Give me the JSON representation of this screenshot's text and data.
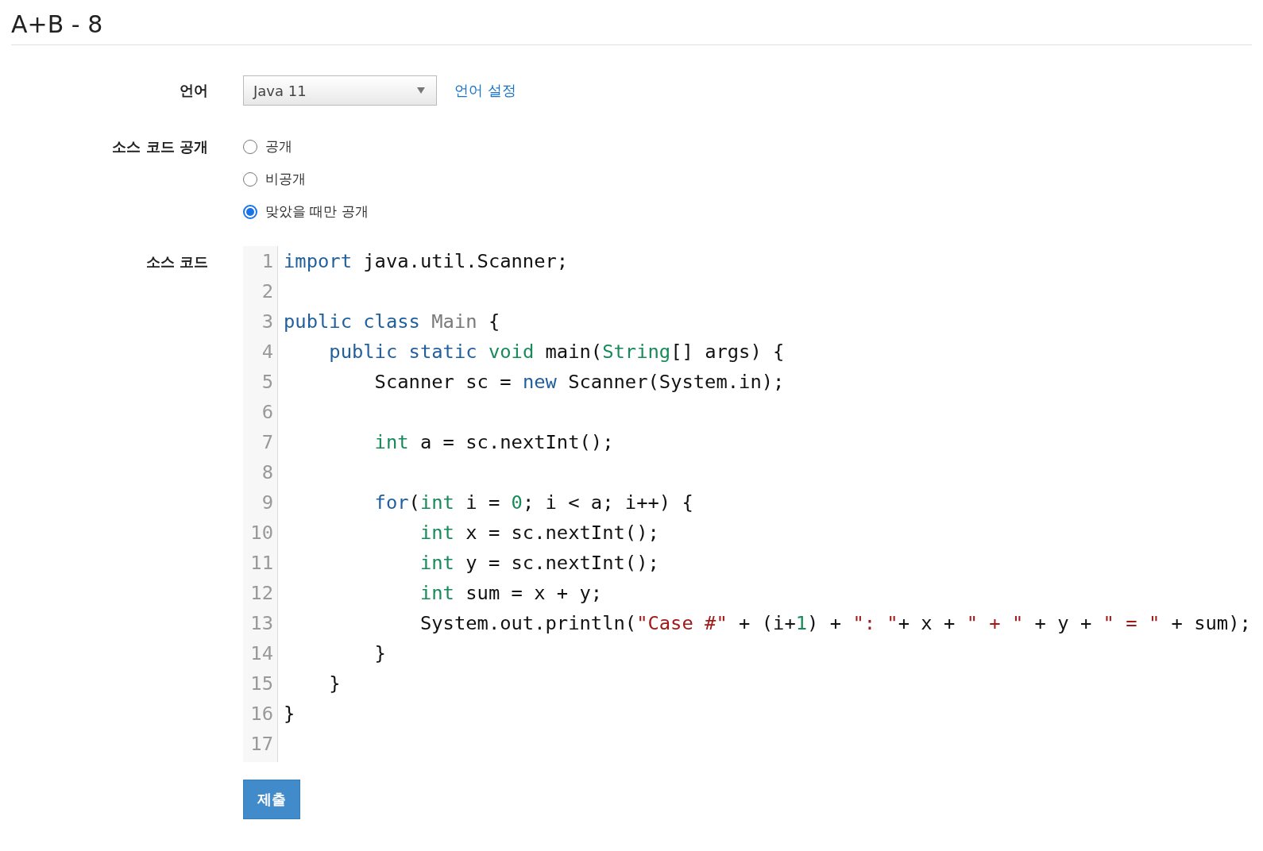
{
  "title": "A+B - 8",
  "language": {
    "label": "언어",
    "value": "Java 11",
    "settings_link": "언어 설정"
  },
  "source_visibility": {
    "label": "소스 코드 공개",
    "options": [
      {
        "label": "공개",
        "selected": false
      },
      {
        "label": "비공개",
        "selected": false
      },
      {
        "label": "맞았을 때만 공개",
        "selected": true
      }
    ]
  },
  "source_code": {
    "label": "소스 코드",
    "lines": [
      {
        "number": "1",
        "tokens": [
          {
            "text": "import",
            "kind": "keyword"
          },
          {
            "text": " java.util.Scanner;",
            "kind": "plain"
          }
        ]
      },
      {
        "number": "2"
      },
      {
        "number": "3",
        "tokens": [
          {
            "text": "public",
            "kind": "keyword"
          },
          {
            "text": " class",
            "kind": "keyword"
          },
          {
            "text": " Main",
            "kind": "def"
          },
          {
            "text": " {",
            "kind": "plain"
          }
        ]
      },
      {
        "number": "4",
        "tokens": [
          {
            "text": "    public",
            "kind": "keyword"
          },
          {
            "text": " static",
            "kind": "keyword"
          },
          {
            "text": " void",
            "kind": "type"
          },
          {
            "text": " main(",
            "kind": "plain"
          },
          {
            "text": "String",
            "kind": "type"
          },
          {
            "text": "[] args) {",
            "kind": "plain"
          }
        ]
      },
      {
        "number": "5",
        "tokens": [
          {
            "text": "        Scanner sc = ",
            "kind": "plain"
          },
          {
            "text": "new",
            "kind": "keyword"
          },
          {
            "text": " Scanner(System.in);",
            "kind": "plain"
          }
        ]
      },
      {
        "number": "6"
      },
      {
        "number": "7",
        "tokens": [
          {
            "text": "        int",
            "kind": "type"
          },
          {
            "text": " a = sc.nextInt();",
            "kind": "plain"
          }
        ]
      },
      {
        "number": "8"
      },
      {
        "number": "9",
        "tokens": [
          {
            "text": "        for",
            "kind": "keyword"
          },
          {
            "text": "(",
            "kind": "plain"
          },
          {
            "text": "int",
            "kind": "type"
          },
          {
            "text": " i = ",
            "kind": "plain"
          },
          {
            "text": "0",
            "kind": "number"
          },
          {
            "text": "; i < a; i++) {",
            "kind": "plain"
          }
        ]
      },
      {
        "number": "10",
        "tokens": [
          {
            "text": "            int",
            "kind": "type"
          },
          {
            "text": " x = sc.nextInt();",
            "kind": "plain"
          }
        ]
      },
      {
        "number": "11",
        "tokens": [
          {
            "text": "            int",
            "kind": "type"
          },
          {
            "text": " y = sc.nextInt();",
            "kind": "plain"
          }
        ]
      },
      {
        "number": "12",
        "tokens": [
          {
            "text": "            int",
            "kind": "type"
          },
          {
            "text": " sum = x + y;",
            "kind": "plain"
          }
        ]
      },
      {
        "number": "13",
        "tokens": [
          {
            "text": "            System.out.println(",
            "kind": "plain"
          },
          {
            "text": "\"Case #\"",
            "kind": "string"
          },
          {
            "text": " + (i+",
            "kind": "plain"
          },
          {
            "text": "1",
            "kind": "number"
          },
          {
            "text": ") + ",
            "kind": "plain"
          },
          {
            "text": "\": \"",
            "kind": "string"
          },
          {
            "text": "+ x + ",
            "kind": "plain"
          },
          {
            "text": "\" + \"",
            "kind": "string"
          },
          {
            "text": " + y + ",
            "kind": "plain"
          },
          {
            "text": "\" = \"",
            "kind": "string"
          },
          {
            "text": " + sum);",
            "kind": "plain"
          }
        ]
      },
      {
        "number": "14",
        "tokens": [
          {
            "text": "        }",
            "kind": "plain"
          }
        ]
      },
      {
        "number": "15",
        "tokens": [
          {
            "text": "    }",
            "kind": "plain"
          }
        ]
      },
      {
        "number": "16",
        "tokens": [
          {
            "text": "}",
            "kind": "plain"
          }
        ]
      },
      {
        "number": "17"
      }
    ]
  },
  "submit_button": "제출"
}
